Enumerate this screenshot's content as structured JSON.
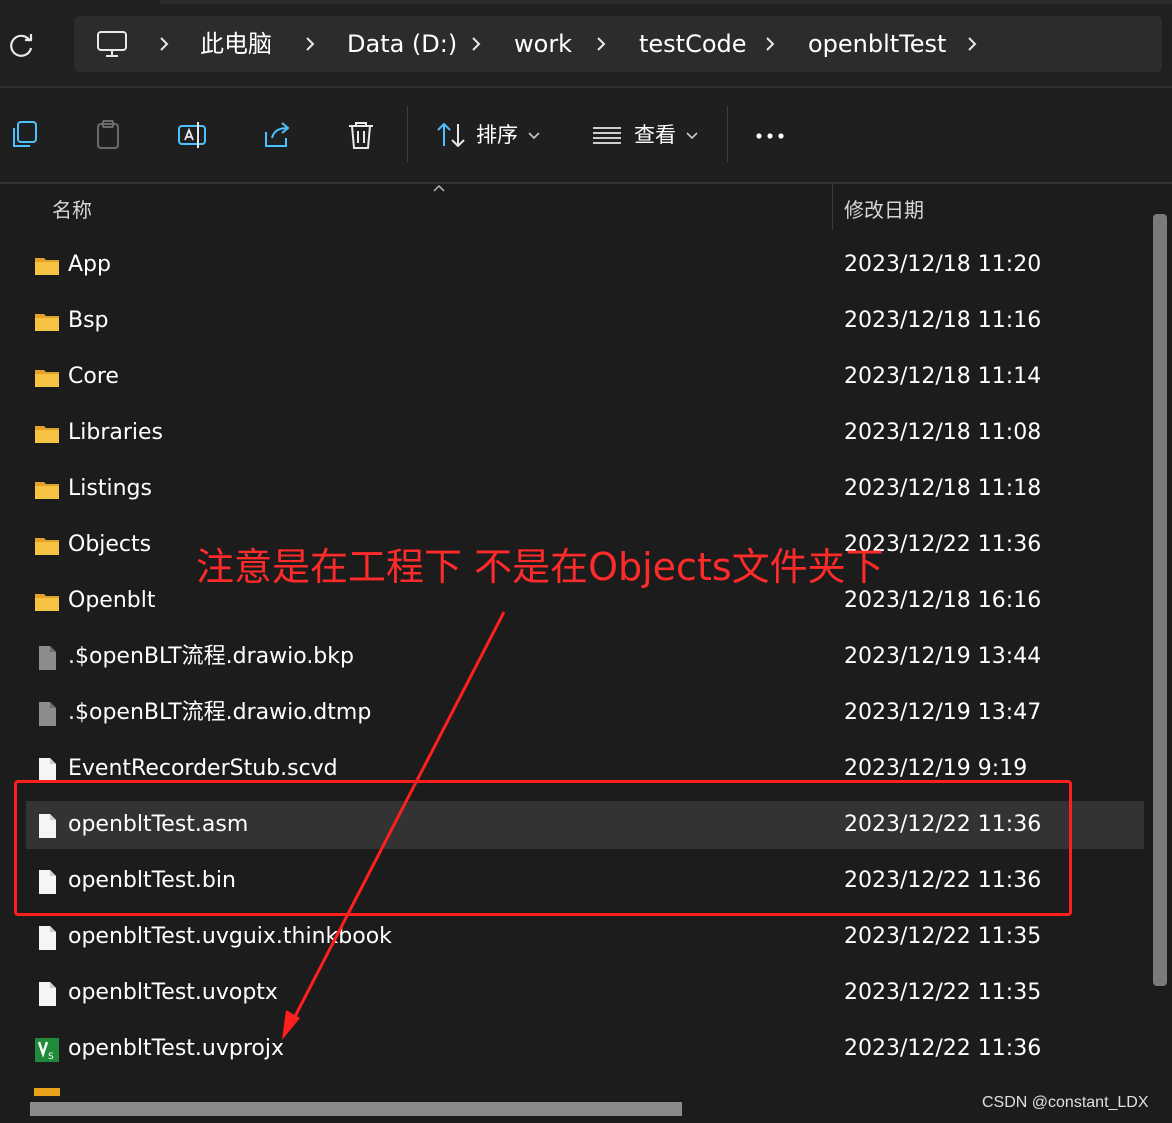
{
  "address_bar": {
    "crumbs": [
      "此电脑",
      "Data (D:)",
      "work",
      "testCode",
      "openbltTest"
    ]
  },
  "toolbar": {
    "sort_label": "排序",
    "view_label": "查看",
    "more_label": "..."
  },
  "columns": {
    "name": "名称",
    "modified": "修改日期"
  },
  "files": [
    {
      "name": "App",
      "date": "2023/12/18 11:20",
      "icon": "folder-icon"
    },
    {
      "name": "Bsp",
      "date": "2023/12/18 11:16",
      "icon": "folder-icon"
    },
    {
      "name": "Core",
      "date": "2023/12/18 11:14",
      "icon": "folder-icon"
    },
    {
      "name": "Libraries",
      "date": "2023/12/18 11:08",
      "icon": "folder-icon"
    },
    {
      "name": "Listings",
      "date": "2023/12/18 11:18",
      "icon": "folder-icon"
    },
    {
      "name": "Objects",
      "date": "2023/12/22 11:36",
      "icon": "folder-icon"
    },
    {
      "name": "Openblt",
      "date": "2023/12/18 16:16",
      "icon": "folder-icon"
    },
    {
      "name": ".$openBLT流程.drawio.bkp",
      "date": "2023/12/19 13:44",
      "icon": "file-gray-icon"
    },
    {
      "name": ".$openBLT流程.drawio.dtmp",
      "date": "2023/12/19 13:47",
      "icon": "file-gray-icon"
    },
    {
      "name": "EventRecorderStub.scvd",
      "date": "2023/12/19 9:19",
      "icon": "file-icon"
    },
    {
      "name": "openbltTest.asm",
      "date": "2023/12/22 11:36",
      "icon": "file-icon",
      "selected": true
    },
    {
      "name": "openbltTest.bin",
      "date": "2023/12/22 11:36",
      "icon": "file-icon"
    },
    {
      "name": "openbltTest.uvguix.thinkbook",
      "date": "2023/12/22 11:35",
      "icon": "file-icon"
    },
    {
      "name": "openbltTest.uvoptx",
      "date": "2023/12/22 11:35",
      "icon": "file-icon"
    },
    {
      "name": "openbltTest.uvprojx",
      "date": "2023/12/22 11:36",
      "icon": "uvision-icon"
    }
  ],
  "annotation": {
    "text": "注意是在工程下 不是在Objects文件夹下",
    "color": "#ff2a2a"
  },
  "watermark": "CSDN @constant_LDX",
  "colors": {
    "folder": "#f0b43c",
    "selected_row": "#333333",
    "annotation_red": "#ff1f1f"
  }
}
